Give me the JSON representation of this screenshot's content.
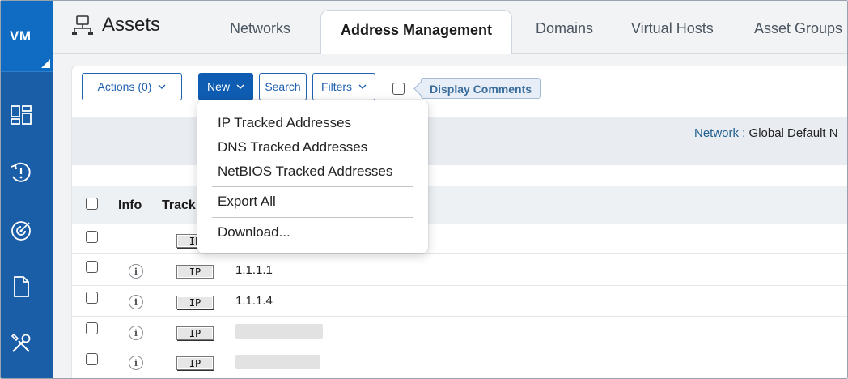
{
  "sidebar": {
    "user_initials": "VM",
    "items": [
      {
        "icon": "dashboard-icon"
      },
      {
        "icon": "alert-history-icon"
      },
      {
        "icon": "radar-icon"
      },
      {
        "icon": "document-icon"
      },
      {
        "icon": "tools-icon"
      }
    ]
  },
  "header": {
    "title": "Assets",
    "title_icon": "network-icon",
    "tabs": [
      {
        "label": "Networks",
        "active": false
      },
      {
        "label": "Address Management",
        "active": true
      },
      {
        "label": "Domains",
        "active": false
      },
      {
        "label": "Virtual Hosts",
        "active": false
      },
      {
        "label": "Asset Groups",
        "active": false
      }
    ]
  },
  "toolbar": {
    "actions_label": "Actions (0)",
    "new_label": "New",
    "search_label": "Search",
    "filters_label": "Filters",
    "display_comments_label": "Display Comments"
  },
  "network": {
    "label": "Network :",
    "value": "Global Default N"
  },
  "table": {
    "columns": [
      "Info",
      "Tracki"
    ],
    "rows": [
      {
        "tracking": "IP",
        "address": "",
        "has_info": false
      },
      {
        "tracking": "IP",
        "address": "1.1.1.1",
        "has_info": true
      },
      {
        "tracking": "IP",
        "address": "1.1.1.4",
        "has_info": true
      },
      {
        "tracking": "IP",
        "address": "",
        "has_info": true
      },
      {
        "tracking": "IP",
        "address": "",
        "has_info": true
      }
    ]
  },
  "new_menu": {
    "items": [
      "IP Tracked Addresses",
      "DNS Tracked Addresses",
      "NetBIOS Tracked Addresses",
      "Export All",
      "Download..."
    ]
  },
  "colors": {
    "sidebar_bg": "#1b5ea8",
    "sidebar_top": "#0f6cc2",
    "primary_button": "#0e5db2",
    "tooltip_bg": "#e7eef7"
  }
}
